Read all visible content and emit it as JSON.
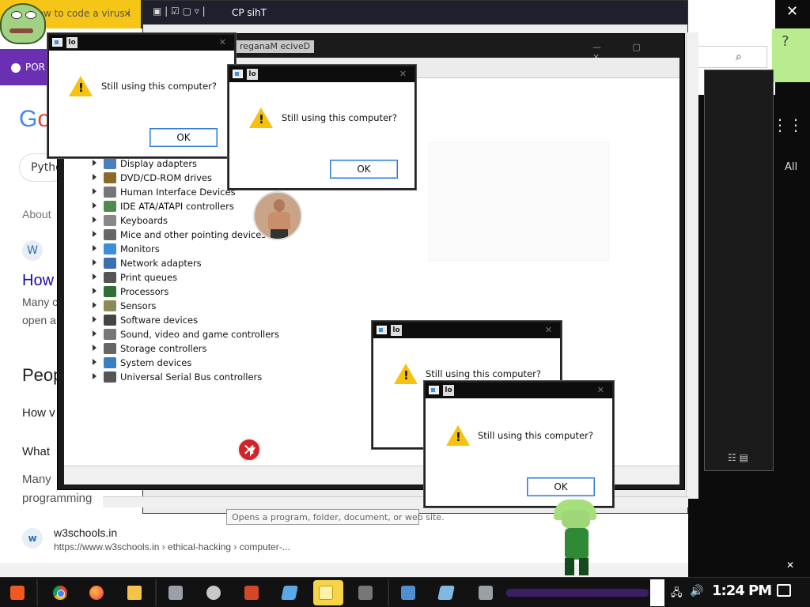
{
  "browser": {
    "tab_title": "how to code a virus i",
    "tab_close": "×",
    "purple_bar_label": "POR",
    "google_logo_part1": "G",
    "google_logo_part2": "o",
    "search_pill": "Pytho",
    "about_label": "About",
    "how_link": "How",
    "snippet_line1": "Many c",
    "snippet_line2": "open a",
    "people_heading": "Peop",
    "paa_q1": "How v",
    "paa_q2": "What",
    "para_line1": "Many",
    "para_line2": "programming",
    "w3_icon": "w",
    "w3_site": "w3schools.in",
    "w3_url": "https://www.w3schools.in › ethical-hacking › computer-..."
  },
  "explorer": {
    "title": "CP sihT",
    "tooltip": "Opens a program, folder, document, or web site."
  },
  "right_panel": {
    "close": "✕",
    "gear_icon": "?",
    "dots_icon": "⋮⋮⋮",
    "all_label": "All",
    "scroll_down": "✕",
    "search_icon": "⌕",
    "view_icons": "☷ ▤"
  },
  "device_manager": {
    "title": "reganaM eciveD",
    "controls": "— ▢ ✕",
    "categories": [
      {
        "label": "Display adapters",
        "icon_color": "#4a7fbd"
      },
      {
        "label": "DVD/CD-ROM drives",
        "icon_color": "#8a6a2a"
      },
      {
        "label": "Human Interface Devices",
        "icon_color": "#777777"
      },
      {
        "label": "IDE ATA/ATAPI controllers",
        "icon_color": "#4f8a4f"
      },
      {
        "label": "Keyboards",
        "icon_color": "#888888"
      },
      {
        "label": "Mice and other pointing devices",
        "icon_color": "#666666"
      },
      {
        "label": "Monitors",
        "icon_color": "#3a8fd6"
      },
      {
        "label": "Network adapters",
        "icon_color": "#3a6fb0"
      },
      {
        "label": "Print queues",
        "icon_color": "#555555"
      },
      {
        "label": "Processors",
        "icon_color": "#2f6e35"
      },
      {
        "label": "Sensors",
        "icon_color": "#8b8b5a"
      },
      {
        "label": "Software devices",
        "icon_color": "#444444"
      },
      {
        "label": "Sound, video and game controllers",
        "icon_color": "#777777"
      },
      {
        "label": "Storage controllers",
        "icon_color": "#666666"
      },
      {
        "label": "System devices",
        "icon_color": "#3a7fc4"
      },
      {
        "label": "Universal Serial Bus controllers",
        "icon_color": "#555555"
      }
    ]
  },
  "dialogs": [
    {
      "id": "dialog-1",
      "title_icon_text": "lo",
      "message": "Still using this computer?",
      "ok_label": "OK",
      "close": "✕"
    },
    {
      "id": "dialog-2",
      "title_icon_text": "lo",
      "message": "Still using this computer?",
      "ok_label": "OK",
      "close": "✕"
    },
    {
      "id": "dialog-3",
      "title_icon_text": "lo",
      "message": "Still using this computer?",
      "ok_label": "OK",
      "close": "✕"
    },
    {
      "id": "dialog-4",
      "title_icon_text": "lo",
      "message": "Still using this computer?",
      "ok_label": "OK",
      "close": "✕"
    }
  ],
  "error_icon": "✕",
  "taskbar": {
    "clock": "1:24 PM",
    "tray_network_icon": "🖧",
    "tray_volume_icon": "🔊"
  },
  "colors": {
    "warning_yellow": "#f5c20f",
    "ok_border": "#2b7ad6",
    "taskbar_bg": "#121212",
    "calc_highlight": "#f6d44a"
  }
}
